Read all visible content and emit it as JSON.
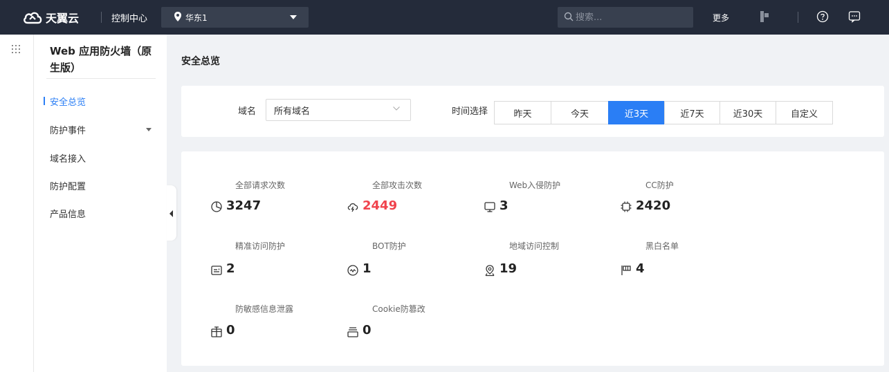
{
  "topbar": {
    "logo_text": "天翼云",
    "console_label": "控制中心",
    "region": "华东1",
    "search_placeholder": "搜索...",
    "more_label": "更多"
  },
  "sidenav": {
    "product_title": "Web 应用防火墙（原生版）",
    "items": [
      {
        "label": "安全总览",
        "active": true
      },
      {
        "label": "防护事件",
        "has_submenu": true
      },
      {
        "label": "域名接入"
      },
      {
        "label": "防护配置"
      },
      {
        "label": "产品信息"
      }
    ]
  },
  "main": {
    "page_title": "安全总览",
    "filter": {
      "domain_label": "域名",
      "domain_value": "所有域名",
      "time_label": "时间选择",
      "time_options": [
        "昨天",
        "今天",
        "近3天",
        "近7天",
        "近30天",
        "自定义"
      ],
      "time_selected": "近3天"
    },
    "stats": [
      {
        "label": "全部请求次数",
        "value": "3247",
        "icon": "pie-chart-icon"
      },
      {
        "label": "全部攻击次数",
        "value": "2449",
        "icon": "cloud-bolt-icon",
        "highlight": "#f0434d"
      },
      {
        "label": "Web入侵防护",
        "value": "3",
        "icon": "monitor-icon"
      },
      {
        "label": "CC防护",
        "value": "2420",
        "icon": "chip-icon"
      },
      {
        "label": "精准访问防护",
        "value": "2",
        "icon": "id-card-icon"
      },
      {
        "label": "BOT防护",
        "value": "1",
        "icon": "bot-face-icon"
      },
      {
        "label": "地域访问控制",
        "value": "19",
        "icon": "map-pin-icon"
      },
      {
        "label": "黑白名单",
        "value": "4",
        "icon": "flag-icon"
      },
      {
        "label": "防敏感信息泄露",
        "value": "0",
        "icon": "box-icon"
      },
      {
        "label": "Cookie防篡改",
        "value": "0",
        "icon": "server-stack-icon"
      }
    ]
  },
  "colors": {
    "topbar_bg": "#242b3a",
    "accent": "#2a7ef5",
    "attack_red": "#f0434d"
  }
}
